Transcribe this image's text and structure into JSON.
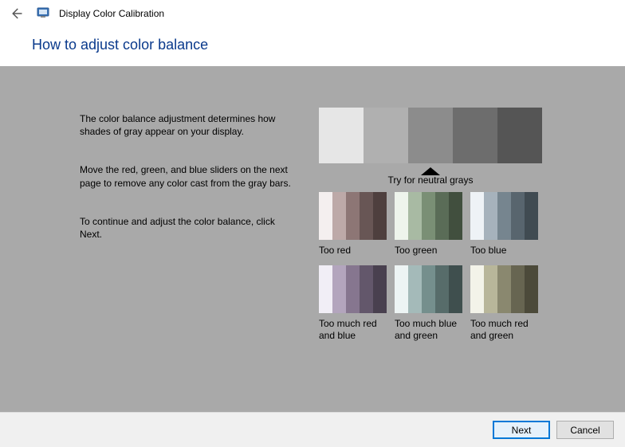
{
  "window": {
    "title": "Display Color Calibration"
  },
  "page": {
    "heading": "How to adjust color balance"
  },
  "text": {
    "para1": "The color balance adjustment determines how shades of gray appear on your display.",
    "para2": "Move the red, green, and blue sliders on the next page to remove any color cast from the gray bars.",
    "para3": "To continue and adjust the color balance, click Next."
  },
  "neutral": {
    "label": "Try for neutral grays",
    "shades": [
      "#e6e6e6",
      "#b0b0b0",
      "#8c8c8c",
      "#6d6d6d",
      "#555555"
    ]
  },
  "examples": [
    {
      "label": "Too red",
      "shades": [
        "#f4efef",
        "#bda9a8",
        "#8d7675",
        "#685655",
        "#4e3f3e"
      ]
    },
    {
      "label": "Too green",
      "shades": [
        "#eef4ec",
        "#a8baa3",
        "#7a8f75",
        "#5a6c57",
        "#414f3e"
      ]
    },
    {
      "label": "Too blue",
      "shades": [
        "#eef2f6",
        "#a6b2bc",
        "#76858f",
        "#58656e",
        "#404b52"
      ]
    },
    {
      "label": "Too much red and blue",
      "shades": [
        "#f1eef6",
        "#b3a5bd",
        "#86768f",
        "#63576b",
        "#49404f"
      ]
    },
    {
      "label": "Too much blue and green",
      "shades": [
        "#edf4f4",
        "#a4bab9",
        "#758f8d",
        "#576c6a",
        "#3f4f4e"
      ]
    },
    {
      "label": "Too much red and green",
      "shades": [
        "#f3f3e9",
        "#b8b69a",
        "#8a886f",
        "#676551",
        "#4c4a3a"
      ]
    }
  ],
  "buttons": {
    "next": "Next",
    "cancel": "Cancel"
  }
}
